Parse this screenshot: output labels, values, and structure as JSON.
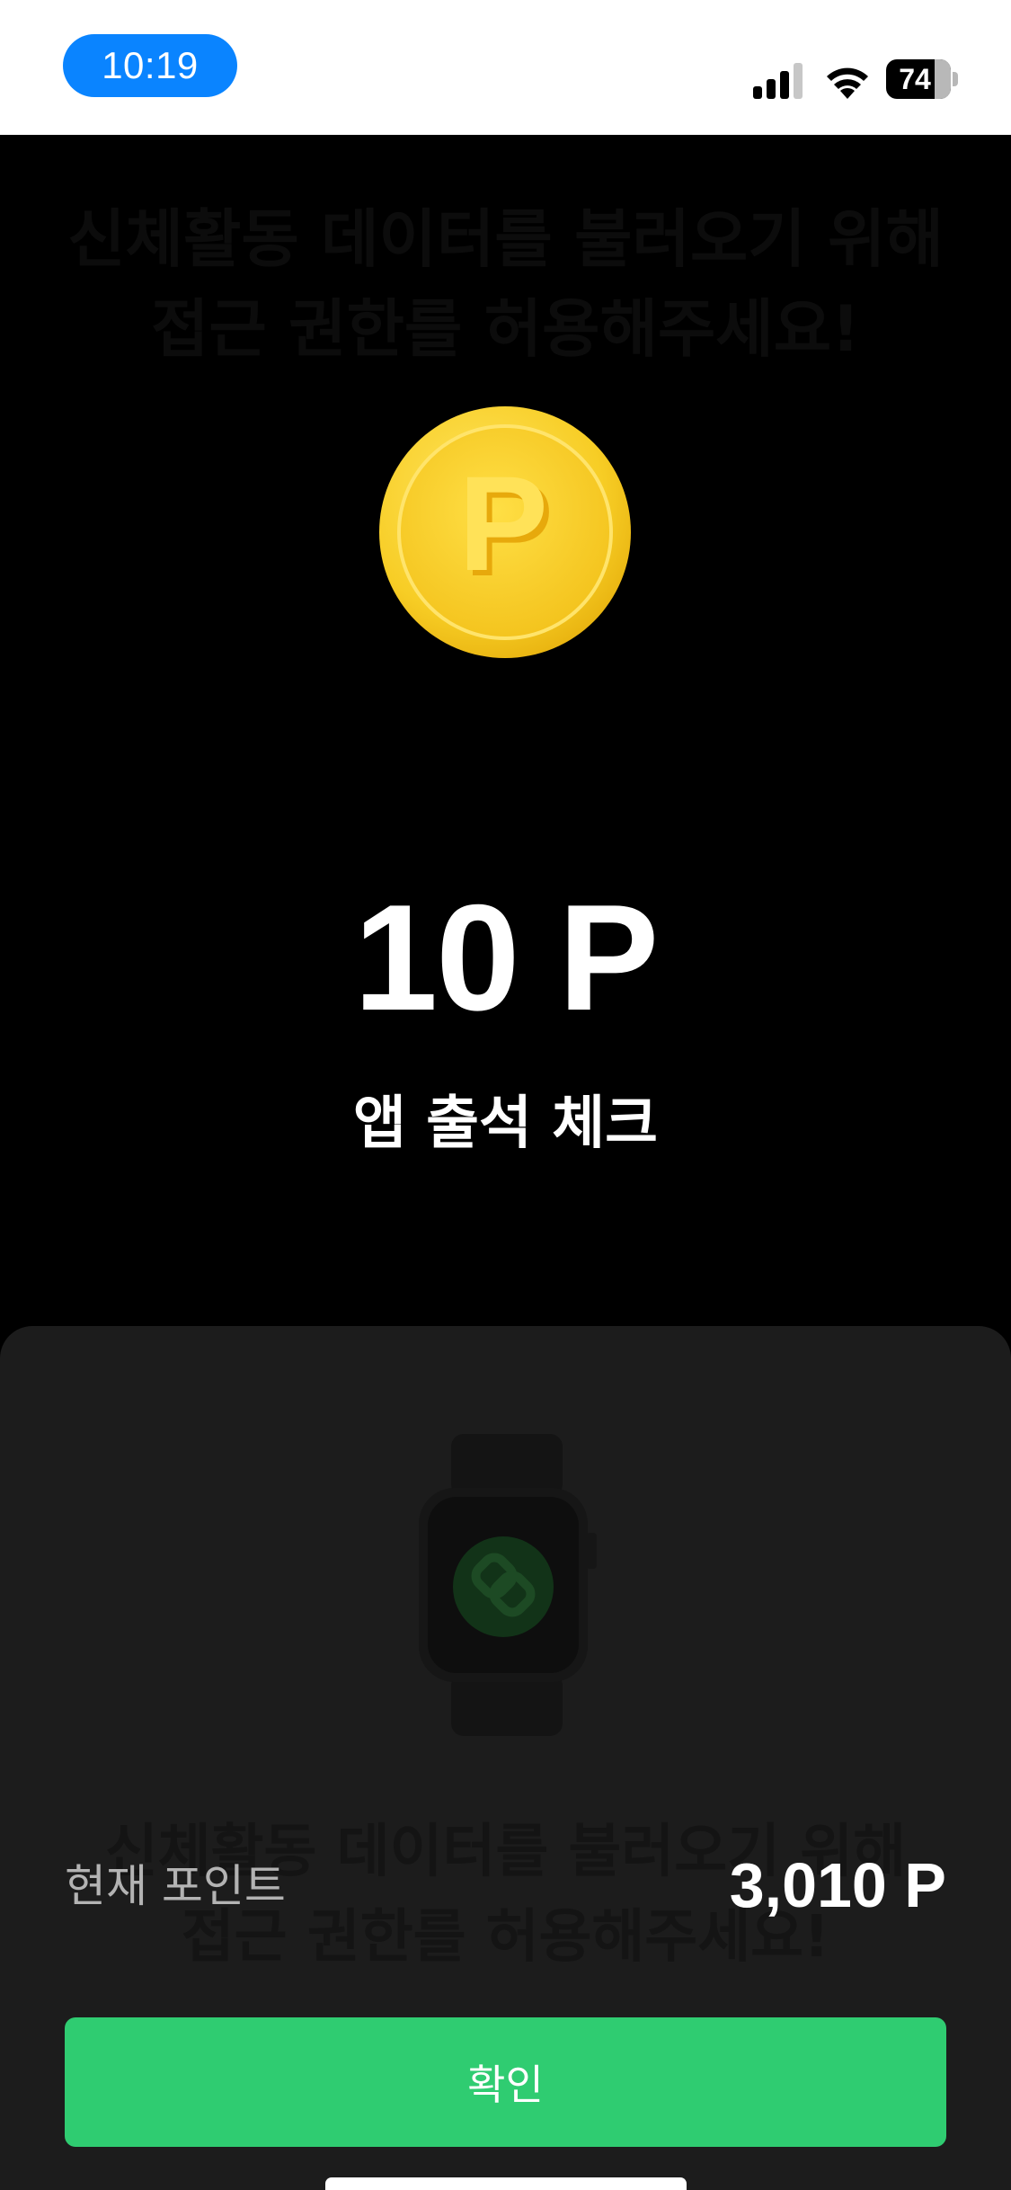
{
  "status_bar": {
    "time": "10:19",
    "battery": "74",
    "icons": [
      "signal-icon",
      "wifi-icon",
      "battery-icon"
    ]
  },
  "background_text": {
    "line1": "신체활동 데이터를 불러오기 위해",
    "line2": "접근 권한를 허용해주세요!"
  },
  "reward": {
    "coin_letter": "P",
    "amount": "10 P",
    "title": "앱 출석 체크"
  },
  "sheet": {
    "current_points_label": "현재 포인트",
    "current_points_value": "3,010 P",
    "confirm_label": "확인"
  },
  "colors": {
    "time_pill": "#0a84ff",
    "confirm_button": "#2fcc71",
    "coin": "#f7cd25",
    "sheet_bg": "#1c1c1c"
  }
}
